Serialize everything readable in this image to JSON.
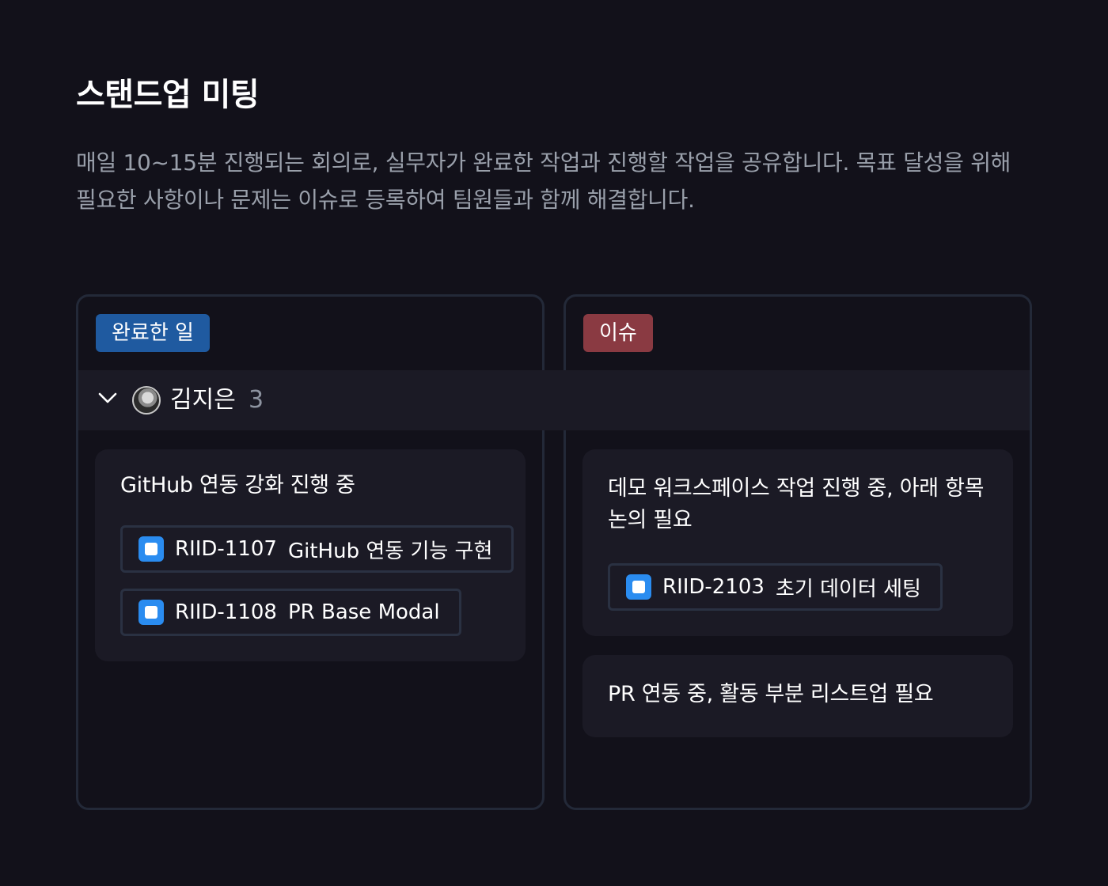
{
  "page": {
    "title": "스탠드업 미팅",
    "description": "매일 10~15분 진행되는 회의로, 실무자가 완료한 작업과 진행할 작업을 공유합니다. 목표 달성을 위해 필요한 사항이나 문제는 이슈로 등록하여 팀원들과 함께 해결합니다."
  },
  "columns": [
    {
      "label": "완료한 일",
      "color": "#1f5aa0"
    },
    {
      "label": "이슈",
      "color": "#8a3a42"
    }
  ],
  "group": {
    "member_name": "김지은",
    "count": "3",
    "expanded": true
  },
  "done_cards": [
    {
      "title": "GitHub 연동 강화 진행 중",
      "items": [
        {
          "key": "RIID-1107",
          "label": "GitHub 연동 기능 구현"
        },
        {
          "key": "RIID-1108",
          "label": "PR Base Modal"
        }
      ]
    }
  ],
  "issue_cards": [
    {
      "title_line1": "데모 워크스페이스 작업 진행 중, 아래 항목",
      "title_line2": "논의 필요",
      "items": [
        {
          "key": "RIID-2103",
          "label": "초기 데이터 세팅"
        }
      ]
    },
    {
      "title": "PR 연동 중, 활동 부분 리스트업 필요"
    }
  ],
  "colors": {
    "background": "#12111a",
    "card": "#1b1a25",
    "issue_icon": "#2a8cf0"
  }
}
